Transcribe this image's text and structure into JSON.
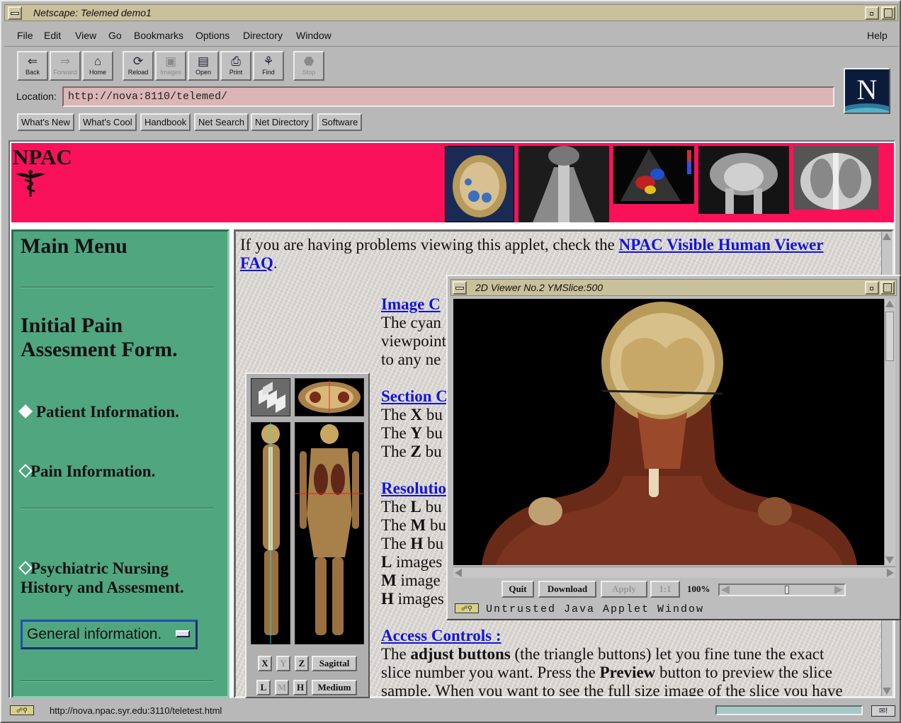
{
  "window": {
    "title": "Netscape: Telemed demo1"
  },
  "menubar": {
    "items": [
      "File",
      "Edit",
      "View",
      "Go",
      "Bookmarks",
      "Options",
      "Directory",
      "Window"
    ],
    "help": "Help"
  },
  "toolbar": {
    "buttons": [
      {
        "label": "Back",
        "icon": "back-arrow-icon",
        "enabled": true
      },
      {
        "label": "Forward",
        "icon": "forward-arrow-icon",
        "enabled": false
      },
      {
        "label": "Home",
        "icon": "home-icon",
        "enabled": true
      },
      {
        "label": "Reload",
        "icon": "reload-icon",
        "enabled": true
      },
      {
        "label": "Images",
        "icon": "images-icon",
        "enabled": false
      },
      {
        "label": "Open",
        "icon": "open-icon",
        "enabled": true
      },
      {
        "label": "Print",
        "icon": "print-icon",
        "enabled": true
      },
      {
        "label": "Find",
        "icon": "find-icon",
        "enabled": true
      },
      {
        "label": "Stop",
        "icon": "stop-icon",
        "enabled": false
      }
    ]
  },
  "location": {
    "label": "Location:",
    "url": "http://nova:8110/telemed/"
  },
  "directory_buttons": [
    "What's New",
    "What's Cool",
    "Handbook",
    "Net Search",
    "Net Directory",
    "Software"
  ],
  "banner": {
    "title": "NPAC"
  },
  "menu": {
    "heading": "Main Menu",
    "form_title_1": "Initial Pain",
    "form_title_2": "Assesment Form.",
    "items": [
      "Patient Information.",
      "Pain Information.",
      "Psychiatric Nursing"
    ],
    "item3_line2": "History and Assesment.",
    "select_value": "General information."
  },
  "main": {
    "intro_text": "If you are having problems viewing this applet, check the ",
    "intro_link_1": "NPAC Visible Human Viewer",
    "intro_link_2": "FAQ",
    "intro_end": ".",
    "sec_image_heading": "Image C",
    "sec_image_lines": [
      "The cyan",
      "viewpoint",
      "to any ne"
    ],
    "sec_section_heading": "Section C",
    "sec_section_lines": [
      {
        "pre": "The ",
        "key": "X",
        "post": " bu"
      },
      {
        "pre": "The ",
        "key": "Y",
        "post": " bu"
      },
      {
        "pre": "The ",
        "key": "Z",
        "post": " bu"
      }
    ],
    "sec_res_heading": "Resolutio",
    "sec_res_lines": [
      {
        "pre": "The ",
        "key": "L",
        "post": " bu"
      },
      {
        "pre": "The ",
        "key": "M",
        "post": " bu"
      },
      {
        "pre": "The ",
        "key": "H",
        "post": " bu"
      },
      {
        "pre": "",
        "key": "L",
        "post": " images"
      },
      {
        "pre": "",
        "key": "M",
        "post": " image"
      },
      {
        "pre": "",
        "key": "H",
        "post": " images"
      }
    ],
    "access_heading": "Access Controls :",
    "access_l1_a": "The ",
    "access_l1_b": "adjust buttons",
    "access_l1_c": " (the triangle buttons) let you fine tune the exact",
    "access_l2_a": "slice number you want. Press the ",
    "access_l2_b": "Preview",
    "access_l2_c": " button to preview the slice",
    "access_l3": "sample. When you want to see the full size image of the slice you have"
  },
  "applet": {
    "axis_buttons": [
      {
        "label": "X",
        "enabled": true
      },
      {
        "label": "Y",
        "enabled": false
      },
      {
        "label": "Z",
        "enabled": true
      }
    ],
    "view_button": "Sagittal",
    "res_buttons": [
      {
        "label": "L",
        "enabled": true
      },
      {
        "label": "M",
        "enabled": false
      },
      {
        "label": "H",
        "enabled": true
      }
    ],
    "res_value": "Medium"
  },
  "viewer": {
    "title": "2D Viewer No.2 YMSlice:500",
    "buttons": [
      {
        "label": "Quit",
        "enabled": true
      },
      {
        "label": "Download",
        "enabled": true
      },
      {
        "label": "Apply",
        "enabled": false
      },
      {
        "label": "1:1",
        "enabled": false
      }
    ],
    "zoom": "100%",
    "zoom_slider_fraction": 0.55,
    "warning": "Untrusted Java Applet Window"
  },
  "status": {
    "url": "http://nova.npac.syr.edu:3110/teletest.html",
    "progress": 0
  },
  "colors": {
    "banner": "#f9115a",
    "menu_bg": "#4fa67f",
    "link": "#1414d8",
    "titlebar": "#c9c19c",
    "location_bg": "#dcb6b6"
  }
}
